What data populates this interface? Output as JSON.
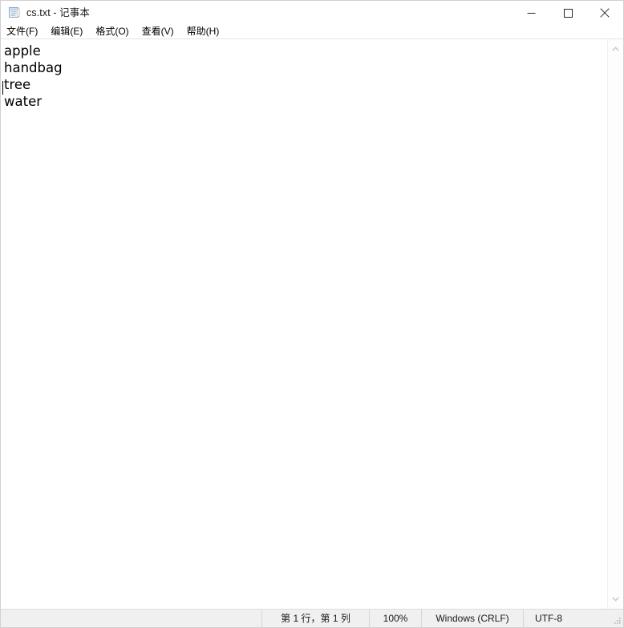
{
  "window": {
    "title": "cs.txt - 记事本",
    "icon": "notepad-document-icon",
    "controls": {
      "minimize": "最小化",
      "maximize": "最大化",
      "close": "关闭"
    }
  },
  "menubar": {
    "items": [
      {
        "label": "文件(F)",
        "name": "menu-file"
      },
      {
        "label": "编辑(E)",
        "name": "menu-edit"
      },
      {
        "label": "格式(O)",
        "name": "menu-format"
      },
      {
        "label": "查看(V)",
        "name": "menu-view"
      },
      {
        "label": "帮助(H)",
        "name": "menu-help"
      }
    ]
  },
  "editor": {
    "lines": [
      "apple",
      "handbag",
      "tree",
      "water"
    ],
    "caret": {
      "line": 1,
      "column": 1
    }
  },
  "scrollbar": {
    "up_arrow": "scroll-up-icon",
    "down_arrow": "scroll-down-icon"
  },
  "statusbar": {
    "position": "第 1 行，第 1 列",
    "zoom": "100%",
    "line_ending": "Windows (CRLF)",
    "encoding": "UTF-8"
  },
  "colors": {
    "window_bg": "#ffffff",
    "statusbar_bg": "#f0f0f0",
    "text": "#000000",
    "border": "#d0d0d0"
  }
}
